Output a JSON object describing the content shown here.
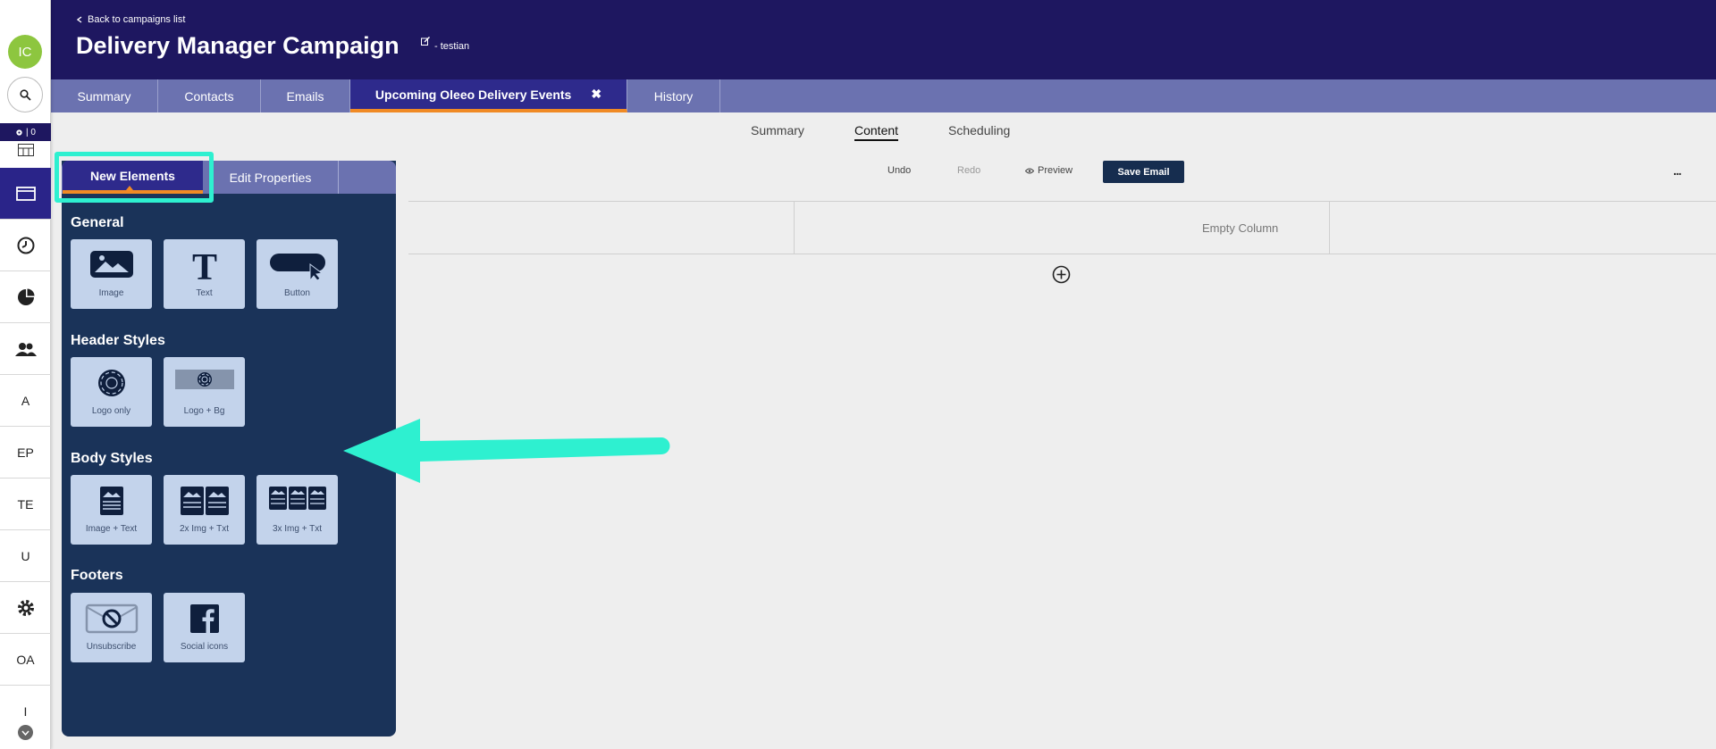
{
  "rail": {
    "avatar": "IC",
    "badge": "| 0",
    "items": [
      "A",
      "EP",
      "TE",
      "U",
      "OA",
      "I"
    ]
  },
  "header": {
    "back_label": "Back to campaigns list",
    "title": "Delivery Manager Campaign",
    "subtitle": "- testian"
  },
  "tabs": [
    {
      "label": "Summary"
    },
    {
      "label": "Contacts"
    },
    {
      "label": "Emails"
    },
    {
      "label": "Upcoming Oleeo Delivery Events",
      "close": "✖"
    },
    {
      "label": "History"
    }
  ],
  "subnav": [
    "Summary",
    "Content",
    "Scheduling"
  ],
  "toolbar": {
    "undo": "Undo",
    "redo": "Redo",
    "preview": "Preview",
    "save": "Save Email",
    "more": "..."
  },
  "canvas": {
    "empty_column": "Empty Column"
  },
  "panel": {
    "tab_new": "New Elements",
    "tab_edit": "Edit Properties",
    "sections": [
      {
        "title": "General",
        "tiles": [
          "Image",
          "Text",
          "Button"
        ]
      },
      {
        "title": "Header Styles",
        "tiles": [
          "Logo only",
          "Logo + Bg"
        ]
      },
      {
        "title": "Body Styles",
        "tiles": [
          "Image + Text",
          "2x Img + Txt",
          "3x Img + Txt"
        ]
      },
      {
        "title": "Footers",
        "tiles": [
          "Unsubscribe",
          "Social icons"
        ]
      }
    ]
  },
  "colors": {
    "header": "#1e1760",
    "tabbar": "#6b72b0",
    "active_tab": "#2e2a8c",
    "accent": "#f08a24",
    "panel": "#1a3359",
    "tile": "#c3d3eb",
    "highlight": "#2ef0d0",
    "avatar": "#8dc63f"
  }
}
